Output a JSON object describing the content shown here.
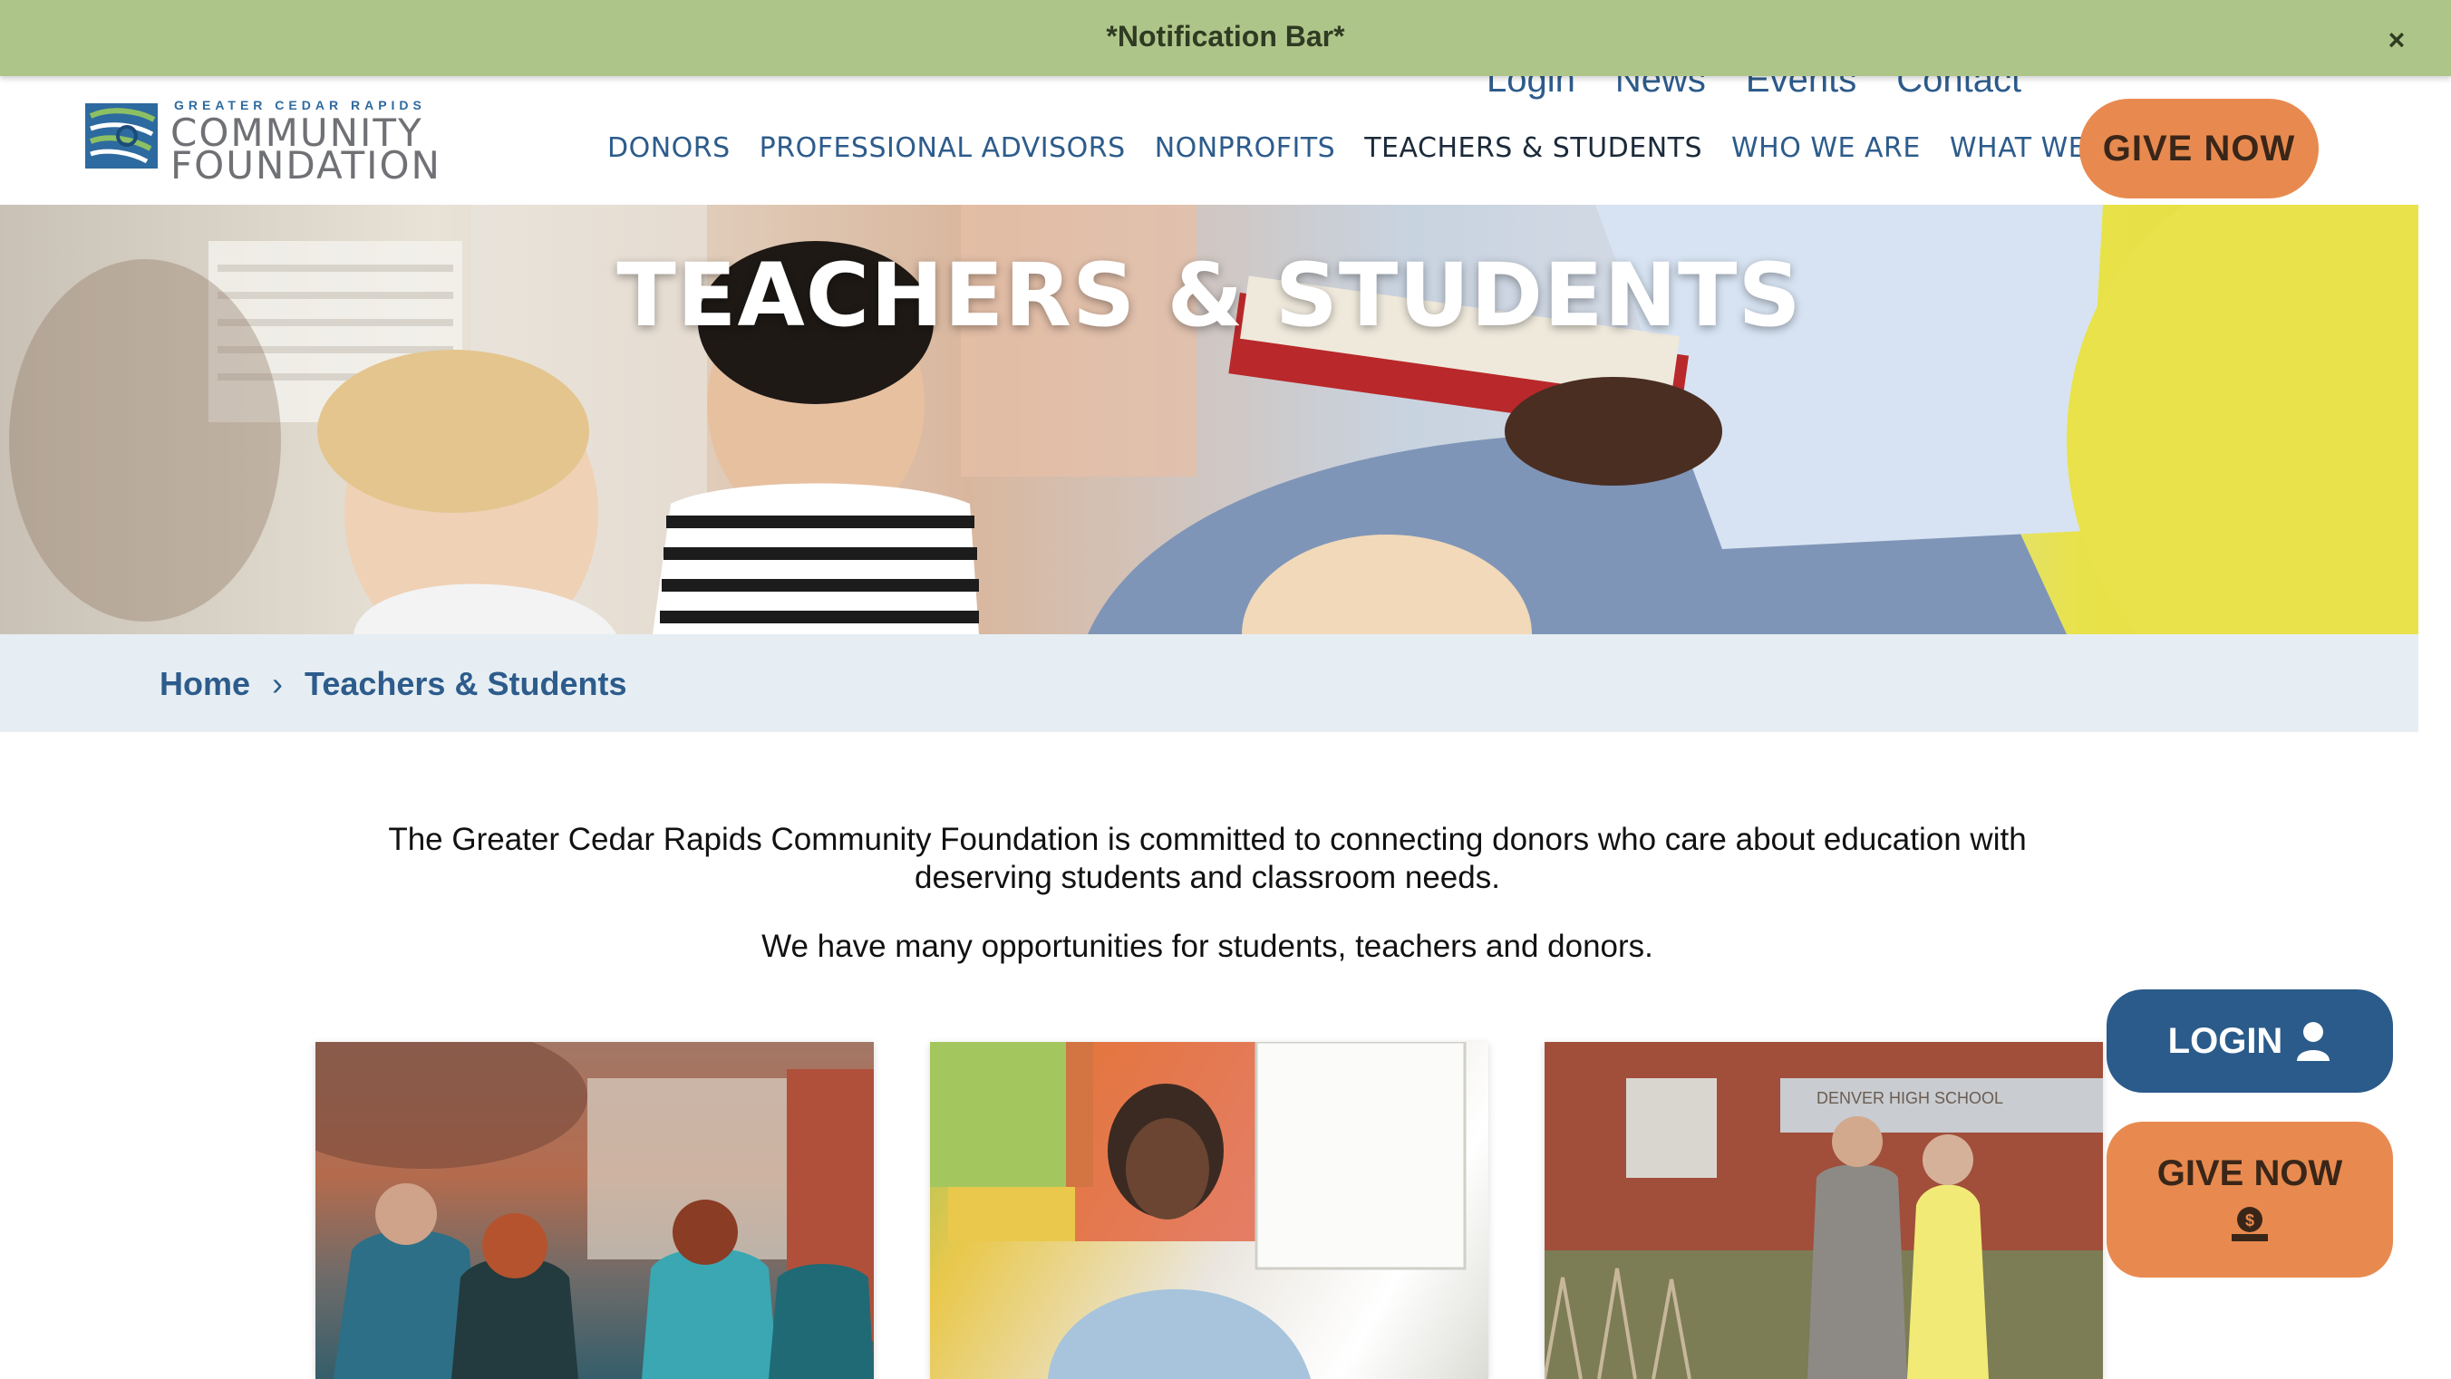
{
  "notification_bar": {
    "text": "*Notification Bar*",
    "close_label": "×"
  },
  "logo": {
    "small_text": "GREATER CEDAR RAPIDS",
    "line1": "COMMUNITY",
    "line2": "FOUNDATION"
  },
  "utility_nav": [
    {
      "label": "Login"
    },
    {
      "label": "News"
    },
    {
      "label": "Events"
    },
    {
      "label": "Contact"
    }
  ],
  "main_nav": [
    {
      "label": "DONORS"
    },
    {
      "label": "PROFESSIONAL ADVISORS"
    },
    {
      "label": "NONPROFITS"
    },
    {
      "label": "TEACHERS & STUDENTS"
    },
    {
      "label": "WHO WE ARE"
    },
    {
      "label": "WHAT WE DO"
    }
  ],
  "header_give_label": "GIVE NOW",
  "hero": {
    "title": "TEACHERS & STUDENTS"
  },
  "breadcrumb": {
    "home": "Home",
    "separator": "›",
    "current": "Teachers & Students"
  },
  "intro": {
    "p1": "The Greater Cedar Rapids Community Foundation is committed to connecting donors who care about education with deserving students and classroom needs.",
    "p2": "We have many opportunities for students, teachers and donors."
  },
  "cards": [
    {
      "image_alt": "students-walking-photo"
    },
    {
      "image_alt": "teacher-classroom-photo"
    },
    {
      "image_alt": "denver-high-school-donors-photo",
      "sign_text": "DENVER HIGH SCHOOL"
    }
  ],
  "floating": {
    "login_label": "LOGIN",
    "give_label": "GIVE NOW"
  },
  "colors": {
    "brand_blue": "#2a5b8a",
    "accent_orange": "#e88a4f",
    "notif_green": "#aec58a",
    "crumb_bg": "#e6eef3"
  }
}
